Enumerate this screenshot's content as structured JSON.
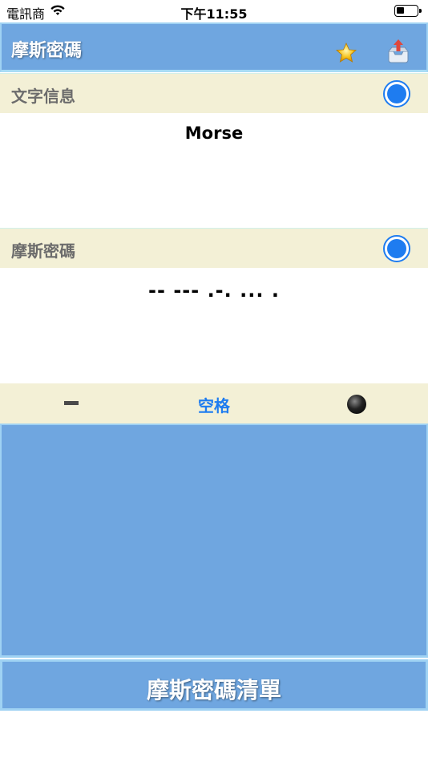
{
  "status_bar": {
    "carrier": "電訊商",
    "time": "下午11:55",
    "battery_level": 0.3
  },
  "nav": {
    "title": "摩斯密碼",
    "star_icon": "star-icon",
    "share_icon": "share-tray-icon"
  },
  "text_section": {
    "label": "文字信息",
    "value": "Morse",
    "selected": true
  },
  "morse_section": {
    "label": "摩斯密碼",
    "value": "-- --- .-. ... .",
    "selected": true
  },
  "keys": {
    "dash_icon": "dash-icon",
    "space_label": "空格",
    "dot_icon": "dot-icon"
  },
  "footer": {
    "list_button_label": "摩斯密碼清單"
  },
  "colors": {
    "accent": "#1e7cf0",
    "nav_blue": "#6fa6e0",
    "header_beige": "#f3f0d6"
  }
}
